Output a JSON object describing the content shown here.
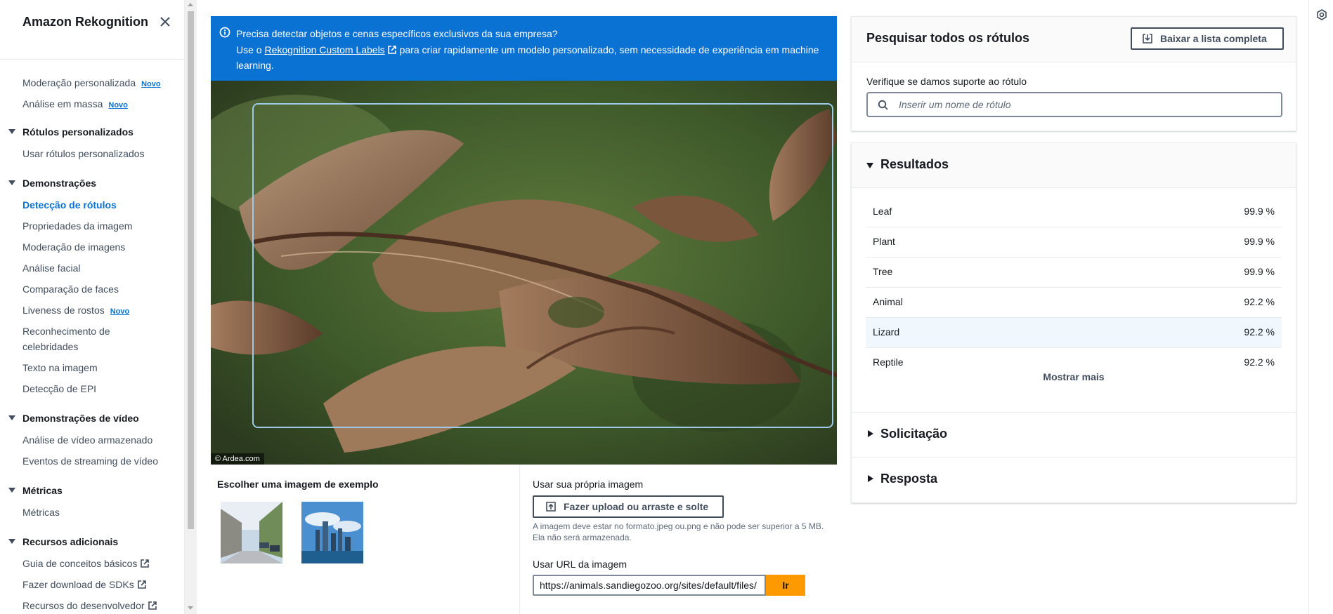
{
  "sidebar": {
    "title": "Amazon Rekognition",
    "new_badge": "Novo",
    "items": {
      "custom_moderation": "Moderação personalizada",
      "bulk_analysis": "Análise em massa",
      "custom_labels_section": "Rótulos personalizados",
      "use_custom_labels": "Usar rótulos personalizados",
      "demos_section": "Demonstrações",
      "label_detection": "Detecção de rótulos",
      "image_properties": "Propriedades da imagem",
      "image_moderation": "Moderação de imagens",
      "facial_analysis": "Análise facial",
      "face_comparison": "Comparação de faces",
      "face_liveness": "Liveness de rostos",
      "celebrity_recognition_1": "Reconhecimento de",
      "celebrity_recognition_2": "celebridades",
      "text_in_image": "Texto na imagem",
      "ppe_detection": "Detecção de EPI",
      "video_demos_section": "Demonstrações de vídeo",
      "stored_video_analysis": "Análise de vídeo armazenado",
      "streaming_video_events": "Eventos de streaming de vídeo",
      "metrics_section": "Métricas",
      "metrics": "Métricas",
      "additional_resources_section": "Recursos adicionais",
      "basic_concepts_guide": "Guia de conceitos básicos",
      "download_sdks": "Fazer download de SDKs",
      "developer_resources": "Recursos do desenvolvedor"
    }
  },
  "banner": {
    "line1": "Precisa detectar objetos e cenas específicos exclusivos da sua empresa?",
    "line2_prefix": "Use o",
    "line2_link": "Rekognition Custom Labels",
    "line2_suffix": "para criar rapidamente um modelo personalizado, sem necessidade de experiência em machine learning."
  },
  "image": {
    "credit": "© Ardea.com",
    "detected_label": "Lizard",
    "detection_confidence_percent": 92.2
  },
  "examples": {
    "title": "Escolher uma imagem de exemplo"
  },
  "upload": {
    "own_image_label": "Usar sua própria imagem",
    "upload_button": "Fazer upload ou arraste e solte",
    "hint": "A imagem deve estar no formato.jpeg ou.png e não pode ser superior a 5 MB. Ela não será armazenada.",
    "url_label": "Usar URL da imagem",
    "url_value": "https://animals.sandiegozoo.org/sites/default/files/",
    "go_button": "Ir"
  },
  "search": {
    "title": "Pesquisar todos os rótulos",
    "download_button": "Baixar a lista completa",
    "field_label": "Verifique se damos suporte ao rótulo",
    "placeholder": "Inserir um nome de rótulo"
  },
  "results": {
    "title": "Resultados",
    "rows": [
      {
        "name": "Leaf",
        "confidence": "99.9 %"
      },
      {
        "name": "Plant",
        "confidence": "99.9 %"
      },
      {
        "name": "Tree",
        "confidence": "99.9 %"
      },
      {
        "name": "Animal",
        "confidence": "92.2 %"
      },
      {
        "name": "Lizard",
        "confidence": "92.2 %"
      },
      {
        "name": "Reptile",
        "confidence": "92.2 %"
      }
    ],
    "show_more": "Mostrar mais",
    "request_title": "Solicitação",
    "response_title": "Resposta"
  },
  "colors": {
    "accent": "#0972d3",
    "primary_button": "#ff9900",
    "highlight_row": "#f0f8fd",
    "bbox": "#9fc9e8"
  },
  "icons": [
    "close-icon",
    "info-icon",
    "external-link-icon",
    "upload-icon",
    "download-icon",
    "search-icon",
    "settings-icon"
  ]
}
